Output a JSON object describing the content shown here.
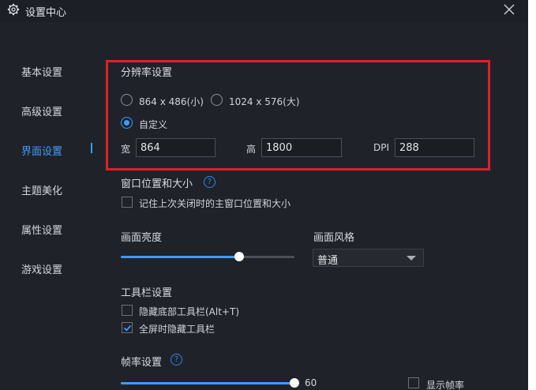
{
  "window": {
    "title": "设置中心",
    "title_icon": "gear-icon",
    "close_icon": "close-icon"
  },
  "sidebar": {
    "items": [
      {
        "label": "基本设置",
        "active": false
      },
      {
        "label": "高级设置",
        "active": false
      },
      {
        "label": "界面设置",
        "active": true
      },
      {
        "label": "主题美化",
        "active": false
      },
      {
        "label": "属性设置",
        "active": false
      },
      {
        "label": "游戏设置",
        "active": false
      }
    ]
  },
  "resolution": {
    "title": "分辨率设置",
    "options": [
      {
        "label": "864 x 486(小)",
        "checked": false
      },
      {
        "label": "1024 x 576(大)",
        "checked": false
      },
      {
        "label": "自定义",
        "checked": true
      }
    ],
    "width_label": "宽",
    "width_value": "864",
    "height_label": "高",
    "height_value": "1800",
    "dpi_label": "DPI",
    "dpi_value": "288"
  },
  "window_pos": {
    "title": "窗口位置和大小",
    "help_icon": "question-circle-icon",
    "help_glyph": "?",
    "remember_label": "记住上次关闭时的主窗口位置和大小",
    "remember_checked": false
  },
  "brightness": {
    "title": "画面亮度",
    "level_fraction": 0.68
  },
  "style": {
    "title": "画面风格",
    "selected": "普通"
  },
  "toolbar": {
    "title": "工具栏设置",
    "hide_bottom_label": "隐藏底部工具栏(Alt+T)",
    "hide_bottom_checked": false,
    "fullscreen_hide_label": "全屏时隐藏工具栏",
    "fullscreen_hide_checked": true
  },
  "framerate": {
    "title": "帧率设置",
    "help_glyph": "?",
    "value": "60",
    "level_fraction": 1.0,
    "show_fps_label": "显示帧率",
    "show_fps_checked": false
  },
  "colors": {
    "accent": "#3f9bff",
    "highlight_box": "#e01e2b",
    "background": "#1f2329"
  }
}
